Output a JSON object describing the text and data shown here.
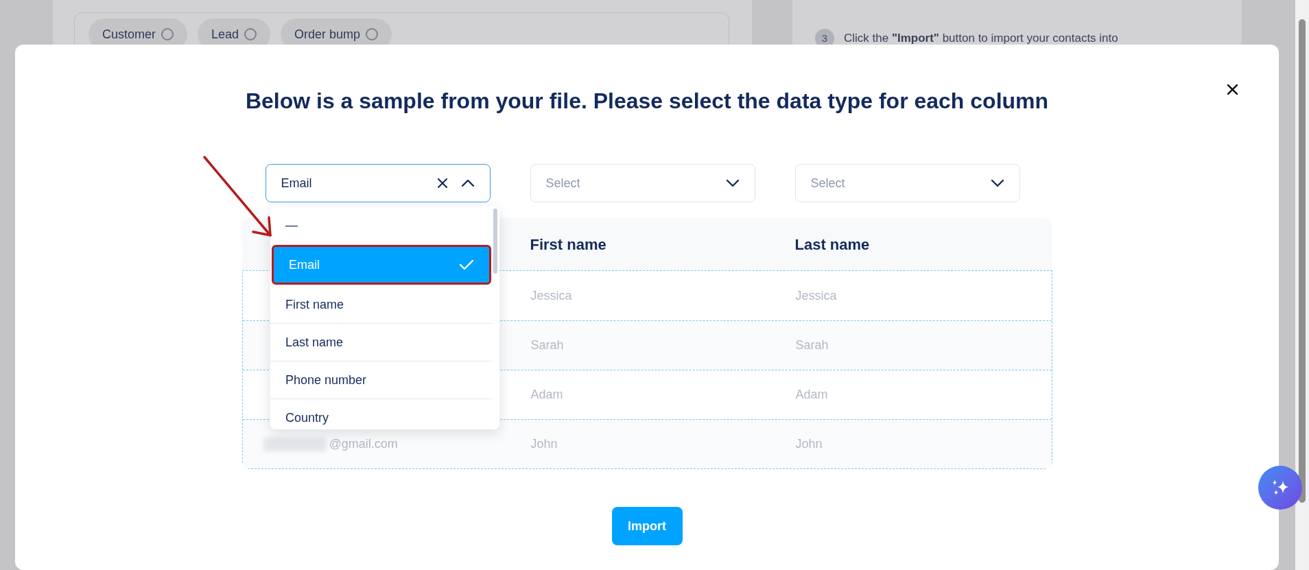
{
  "background": {
    "tags": [
      {
        "label": "Customer"
      },
      {
        "label": "Lead"
      },
      {
        "label": "Order bump"
      }
    ],
    "steps": [
      {
        "number": "3",
        "text": "Click the **\"Import\"** button to import your contacts into"
      }
    ]
  },
  "modal": {
    "title": "Below is a sample from your file. Please select the data type for each column",
    "column_selects": [
      {
        "value": "Email",
        "open": true
      },
      {
        "placeholder": "Select",
        "open": false
      },
      {
        "placeholder": "Select",
        "open": false
      }
    ],
    "dropdown_options": [
      {
        "label": "—",
        "selected": false
      },
      {
        "label": "Email",
        "selected": true
      },
      {
        "label": "First name",
        "selected": false
      },
      {
        "label": "Last name",
        "selected": false
      },
      {
        "label": "Phone number",
        "selected": false
      },
      {
        "label": "Country",
        "selected": false
      }
    ],
    "table": {
      "columns": [
        "First name",
        "Last name"
      ],
      "rows": [
        {
          "cells": [
            "Jessica",
            "Jessica"
          ]
        },
        {
          "cells": [
            "Sarah",
            "Sarah"
          ]
        },
        {
          "cells": [
            "Adam",
            "Adam"
          ]
        },
        {
          "column_1": "@gmail.com",
          "redacted": true,
          "cells": [
            "John",
            "John"
          ]
        }
      ]
    },
    "import_button": "Import"
  }
}
